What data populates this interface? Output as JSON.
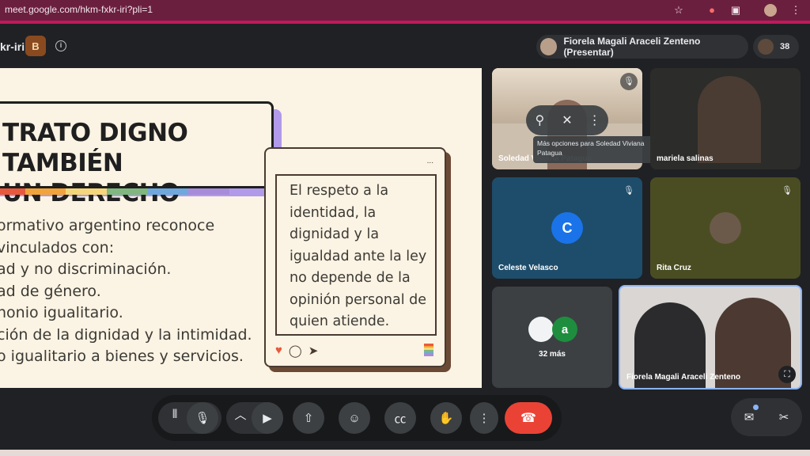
{
  "browser": {
    "url": "meet.google.com/hkm-fxkr-iri?pli=1",
    "icons": [
      "star-icon",
      "extension-pin-icon",
      "puzzle-icon",
      "profile-icon",
      "kebab-icon"
    ]
  },
  "meeting": {
    "code_fragment": "kr-iri",
    "presenter_label": "Fiorela Magali Araceli Zenteno (Presentar)",
    "participant_count": "38"
  },
  "slide": {
    "title_line1": "TRATO DIGNO TAMBIÉN",
    "title_line2": "UN DERECHO",
    "rainbow_colors": [
      "#e8593b",
      "#f2a33a",
      "#f5d67a",
      "#7fb77e",
      "#6fa8dc",
      "#a68cd9"
    ],
    "bullets": [
      "ormativo argentino reconoce",
      "vinculados con:",
      "ad y no discriminación.",
      "ad de género.",
      "nonio igualitario.",
      "ción de la dignidad y la intimidad.",
      "o igualitario a bienes y servicios."
    ],
    "post_dots": "...",
    "post_quote": "El respeto a la identidad, la dignidad y la igualdad ante la ley no depende de la opinión personal de quien atiende."
  },
  "tiles": {
    "soledad": {
      "name": "Soledad Viviana Patagua"
    },
    "mariela": {
      "name": "mariela salinas"
    },
    "celeste": {
      "name": "Celeste Velasco",
      "initial": "C"
    },
    "rita": {
      "name": "Rita Cruz"
    },
    "more": {
      "label": "32 más",
      "initial": "a"
    },
    "fiorela": {
      "name": "Fiorela Magali Araceli Zenteno"
    }
  },
  "tooltip": {
    "text": "Más opciones para Soledad Viviana Patagua"
  },
  "colors": {
    "browser_bar": "#6b1f3f",
    "accent_pink": "#c2185b",
    "end_call": "#ea4335",
    "celeste_tile": "#1e4d6b",
    "rita_tile": "#4a4d22",
    "avatar_blue": "#1a73e8",
    "avatar_green": "#1e8e3e"
  }
}
